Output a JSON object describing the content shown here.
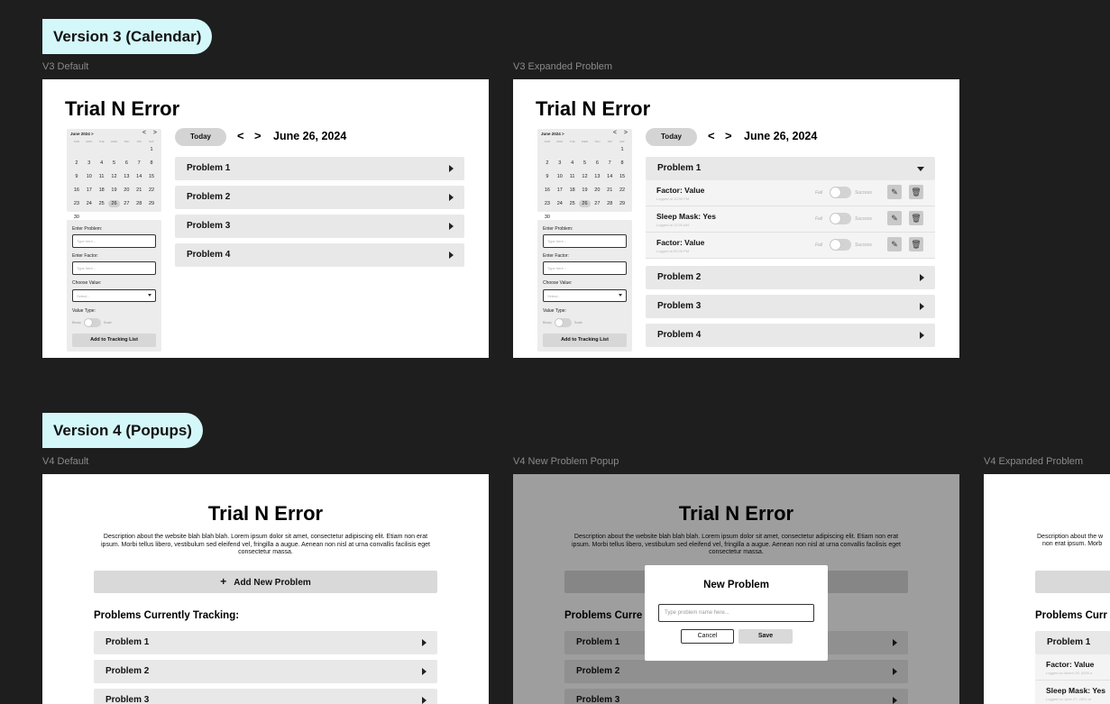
{
  "sections": {
    "v3": "Version 3 (Calendar)",
    "v4": "Version 4 (Popups)"
  },
  "frames": {
    "v3_default": "V3 Default",
    "v3_expanded": "V3 Expanded Problem",
    "v4_default": "V4 Default",
    "v4_popup": "V4 New Problem Popup",
    "v4_expanded": "V4 Expanded Problem"
  },
  "app": {
    "brand": "Trial N Error",
    "today": "Today",
    "prev": "<",
    "next": ">",
    "date": "June 26, 2024"
  },
  "calendar": {
    "month": "June 2024 >",
    "prev": "<",
    "next": ">",
    "dow": [
      "SUN",
      "MON",
      "TUE",
      "WED",
      "THU",
      "FRI",
      "SAT"
    ],
    "days": [
      "",
      "",
      "",
      "",
      "",
      "",
      "1",
      "2",
      "3",
      "4",
      "5",
      "6",
      "7",
      "8",
      "9",
      "10",
      "11",
      "12",
      "13",
      "14",
      "15",
      "16",
      "17",
      "18",
      "19",
      "20",
      "21",
      "22",
      "23",
      "24",
      "25",
      "26",
      "27",
      "28",
      "29",
      "30"
    ],
    "selected": "26"
  },
  "form": {
    "problem_label": "Enter Problem:",
    "problem_placeholder": "Type here...",
    "factor_label": "Enter Factor:",
    "factor_placeholder": "Type here...",
    "value_label": "Choose Value:",
    "value_placeholder": "Select...",
    "type_label": "Value Type:",
    "binary": "Binary",
    "scale": "Scale",
    "add_button": "Add to Tracking List"
  },
  "problems": [
    "Problem 1",
    "Problem 2",
    "Problem 3",
    "Problem 4"
  ],
  "factors": [
    {
      "title": "Factor: Value",
      "logged": "Logged at 10:00 PM"
    },
    {
      "title": "Sleep Mask: Yes",
      "logged": "Logged at 12:00 AM"
    },
    {
      "title": "Factor: Value",
      "logged": "Logged at 00:00 PM"
    }
  ],
  "toggle": {
    "fail": "Fail",
    "success": "Success"
  },
  "icons": {
    "edit": "edit-icon",
    "delete": "trash-icon"
  },
  "v4": {
    "title": "Trial N Error",
    "description": "Description about the website blah blah blah. Lorem ipsum dolor sit amet, consectetur adipiscing elit. Etiam non erat ipsum. Morbi tellus libero, vestibulum sed eleifend vel, fringilla a augue. Aenean non nisl at urna convallis facilisis eget consectetur massa.",
    "add_new": "Add New Problem",
    "tracking": "Problems Currently Tracking:",
    "tracking_short": "Problems Curre",
    "tracking_cut": "Problems Curr",
    "desc_cut_1": "Description about the w",
    "desc_cut_2": "non erat ipsum. Morb",
    "factor1": "Factor: Value",
    "factor1_logged": "Logged on March 00, 0000 a",
    "factor2": "Sleep Mask: Yes",
    "factor2_logged": "Logged on June 17, 2021 at"
  },
  "modal": {
    "title": "New Problem",
    "placeholder": "Type problem name here...",
    "cancel": "Cancel",
    "save": "Save"
  },
  "colors": {
    "background": "#1e1e1e",
    "tag": "#d4f7fa",
    "row": "#e8e8e8"
  }
}
